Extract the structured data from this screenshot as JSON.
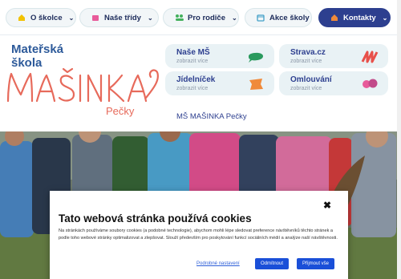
{
  "nav": {
    "items": [
      {
        "label": "O školce",
        "icon": "house-icon",
        "color": "#f2c200"
      },
      {
        "label": "Naše třídy",
        "icon": "class-icon",
        "color": "#e85b9a"
      },
      {
        "label": "Pro rodiče",
        "icon": "parents-icon",
        "color": "#43b05c"
      },
      {
        "label": "Akce školy",
        "icon": "calendar-icon",
        "color": "#42a0c8"
      }
    ],
    "contact": {
      "label": "Kontakty",
      "icon": "contact-icon",
      "color": "#f08a3a"
    }
  },
  "logo": {
    "line1": "Mateřská",
    "line2": "škola",
    "name": "MAŠINKA",
    "town": "Pečky"
  },
  "cards": [
    {
      "title": "Naše MŠ",
      "sub": "zobrazit více",
      "icon": "chat-bubble-icon",
      "color": "#2a9a5e"
    },
    {
      "title": "Strava.cz",
      "sub": "zobrazit více",
      "icon": "scribble-icon",
      "color": "#e8504a"
    },
    {
      "title": "Jídelníček",
      "sub": "zobrazit více",
      "icon": "menu-icon",
      "color": "#f08a3a"
    },
    {
      "title": "Omlouvání",
      "sub": "zobrazit více",
      "icon": "clouds-icon",
      "color": "#e85b9a"
    }
  ],
  "address": "MŠ MAŠINKA Pečky",
  "cookie": {
    "title": "Tato webová stránka používá cookies",
    "text": "Na stránkách používáme soubory cookies (a podobné technologie), abychom mohli lépe sledovat preference návštěvníků těchto stránek a podle toho webové stránky optimalizovat a zlepšovat. Slouží především pro poskytování funkcí sociálních médií a analýze naší návštěvnosti.",
    "settings_label": "Podrobné nastavení",
    "reject_label": "Odmítnout",
    "accept_label": "Přijmout vše",
    "close_glyph": "✖"
  }
}
